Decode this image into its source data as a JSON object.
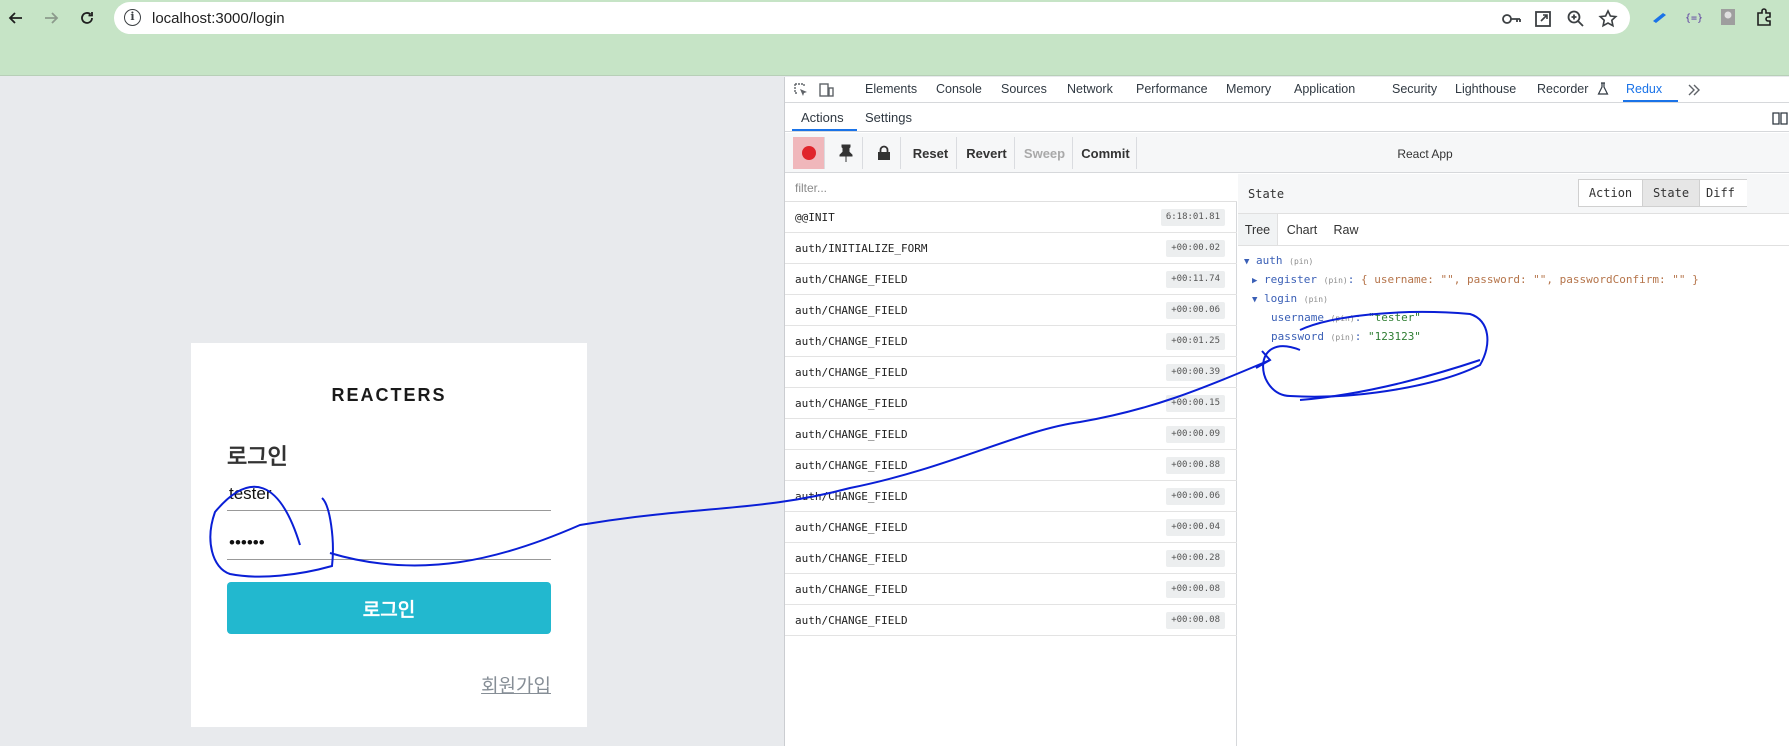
{
  "browser": {
    "url": "localhost:3000/login",
    "icons": [
      "back-arrow-icon",
      "forward-arrow-icon",
      "reload-icon",
      "site-info-icon",
      "password-key-icon",
      "install-app-icon",
      "zoom-icon",
      "bookmark-star-icon",
      "extensions-icon"
    ]
  },
  "page": {
    "brand": "REACTERS",
    "title": "로그인",
    "username_value": "tester",
    "password_value": "123123",
    "submit_label": "로그인",
    "signup_label": "회원가입",
    "accent_color": "#22b8cf"
  },
  "devtools": {
    "tabs": [
      "Elements",
      "Console",
      "Sources",
      "Network",
      "Performance",
      "Memory",
      "Application",
      "Security",
      "Lighthouse",
      "Recorder",
      "Redux"
    ],
    "active_tab": "Redux",
    "subtabs": [
      "Actions",
      "Settings"
    ],
    "toolbar": {
      "reset": "Reset",
      "revert": "Revert",
      "sweep": "Sweep",
      "commit": "Commit",
      "instance": "React App"
    },
    "filter_placeholder": "filter...",
    "actions": [
      {
        "name": "@@INIT",
        "time": "6:18:01.81"
      },
      {
        "name": "auth/INITIALIZE_FORM",
        "time": "+00:00.02"
      },
      {
        "name": "auth/CHANGE_FIELD",
        "time": "+00:11.74"
      },
      {
        "name": "auth/CHANGE_FIELD",
        "time": "+00:00.06"
      },
      {
        "name": "auth/CHANGE_FIELD",
        "time": "+00:01.25"
      },
      {
        "name": "auth/CHANGE_FIELD",
        "time": "+00:00.39"
      },
      {
        "name": "auth/CHANGE_FIELD",
        "time": "+00:00.15"
      },
      {
        "name": "auth/CHANGE_FIELD",
        "time": "+00:00.09"
      },
      {
        "name": "auth/CHANGE_FIELD",
        "time": "+00:00.88"
      },
      {
        "name": "auth/CHANGE_FIELD",
        "time": "+00:00.06"
      },
      {
        "name": "auth/CHANGE_FIELD",
        "time": "+00:00.04"
      },
      {
        "name": "auth/CHANGE_FIELD",
        "time": "+00:00.28"
      },
      {
        "name": "auth/CHANGE_FIELD",
        "time": "+00:00.08"
      },
      {
        "name": "auth/CHANGE_FIELD",
        "time": "+00:00.08"
      }
    ],
    "state_title": "State",
    "state_modes": [
      "Action",
      "State",
      "Diff"
    ],
    "active_mode": "State",
    "view_tabs": [
      "Tree",
      "Chart",
      "Raw"
    ],
    "tree": {
      "root_key": "auth",
      "pin": "(pin)",
      "register_key": "register",
      "register_summary": "{ username: \"\", password: \"\", passwordConfirm: \"\" }",
      "login_key": "login",
      "username_key": "username",
      "username_val": "\"tester\"",
      "password_key": "password",
      "password_val": "\"123123\""
    }
  }
}
